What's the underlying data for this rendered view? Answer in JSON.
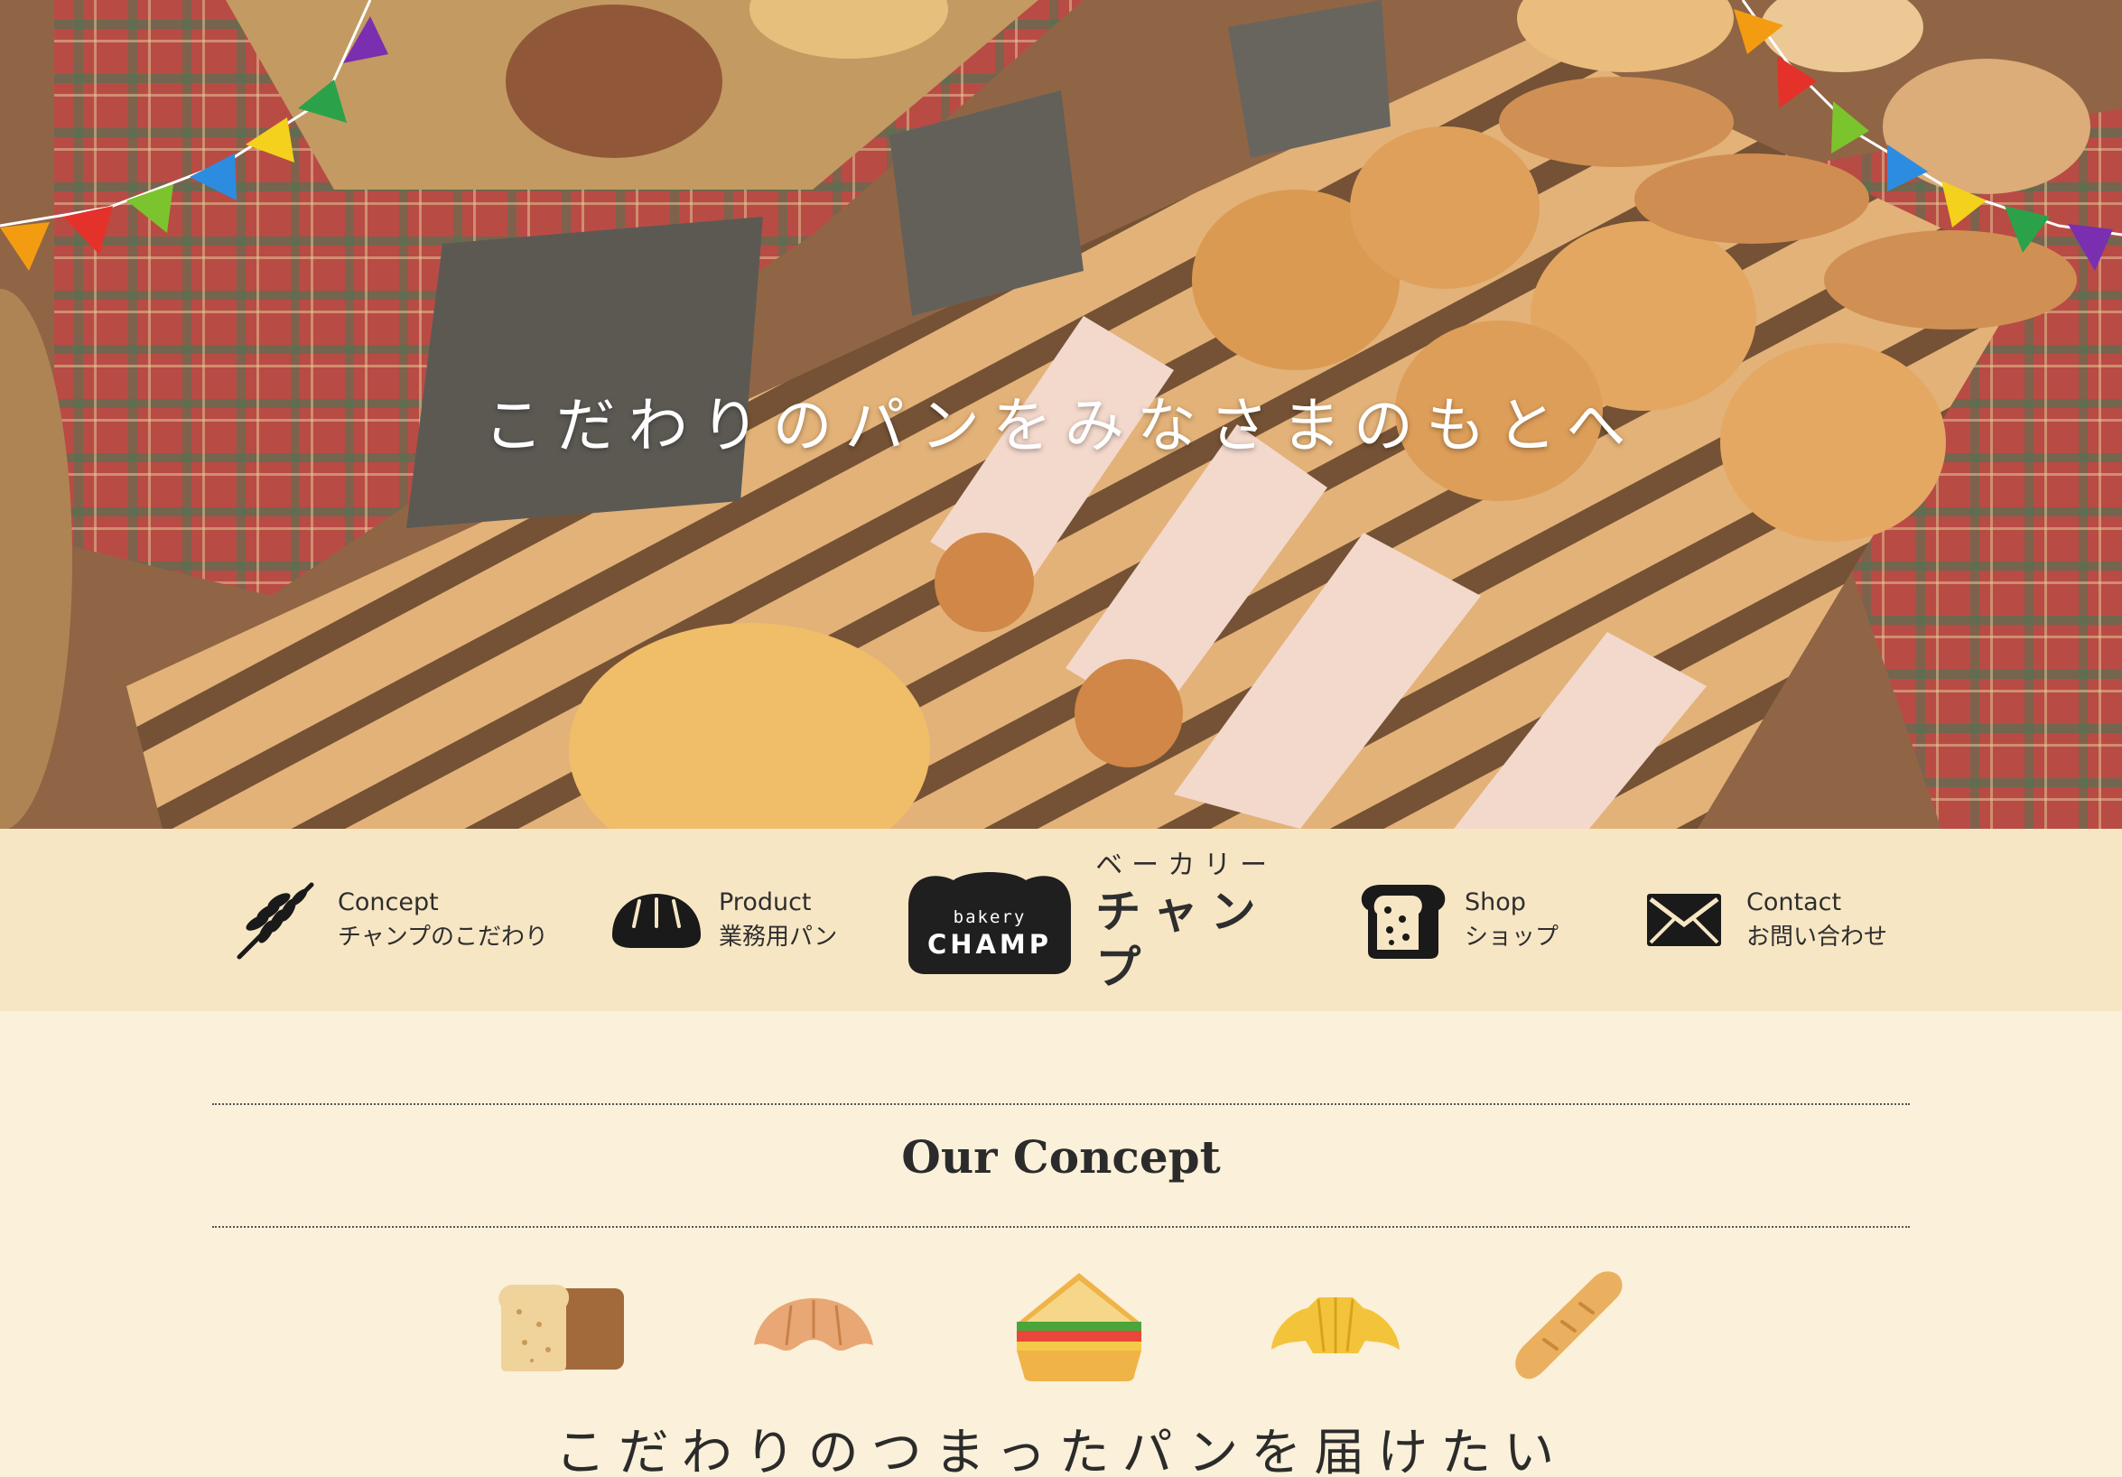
{
  "hero": {
    "headline": "こだわりのパンをみなさまのもとへ"
  },
  "nav": {
    "items": [
      {
        "en": "Concept",
        "ja": "チャンプのこだわり",
        "icon": "wheat-icon"
      },
      {
        "en": "Product",
        "ja": "業務用パン",
        "icon": "bread-loaf-icon"
      },
      {
        "en": "Shop",
        "ja": "ショップ",
        "icon": "toast-icon"
      },
      {
        "en": "Contact",
        "ja": "お問い合わせ",
        "icon": "envelope-icon"
      }
    ],
    "logo": {
      "small": "bakery",
      "big": "CHAMP",
      "kana_small": "ベーカリー",
      "kana_big": "チャンプ"
    }
  },
  "concept": {
    "title": "Our Concept",
    "subtitle": "こだわりのつまったパンを届けたい",
    "icons": [
      "bread-slice-icon",
      "croissant-icon",
      "sandwich-icon",
      "croissant-yellow-icon",
      "baguette-icon"
    ]
  },
  "colors": {
    "nav_bg": "#f7e6c4",
    "page_bg": "#fbf0d9",
    "text": "#2e2e2e",
    "logo_dark": "#1f1f1f"
  }
}
